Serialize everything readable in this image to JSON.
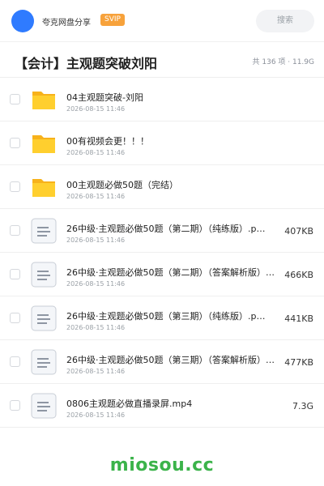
{
  "header": {
    "share_name": "夸克网盘分享",
    "badge": "SVIP",
    "search_placeholder": "搜索",
    "accent_color": "#2f7bff",
    "badge_color": "#f7a23b"
  },
  "titlebar": {
    "title": "【会计】主观题突破刘阳",
    "meta": "共 136 项 · 11.9G"
  },
  "files": [
    {
      "icon": "folder-icon",
      "name": "04主观题突破-刘阳",
      "date": "2026-08-15 11:46",
      "size": ""
    },
    {
      "icon": "folder-icon",
      "name": "00有视频会更！！！",
      "date": "2026-08-15 11:46",
      "size": ""
    },
    {
      "icon": "folder-icon",
      "name": "00主观题必做50题（完结）",
      "date": "2026-08-15 11:46",
      "size": ""
    },
    {
      "icon": "document-icon",
      "name": "26中级·主观题必做50题（第二期）（纯练版）.p…",
      "date": "2026-08-15 11:46",
      "size": "407KB"
    },
    {
      "icon": "document-icon",
      "name": "26中级·主观题必做50题（第二期）（答案解析版）…",
      "date": "2026-08-15 11:46",
      "size": "466KB"
    },
    {
      "icon": "document-icon",
      "name": "26中级·主观题必做50题（第三期）（纯练版）.p…",
      "date": "2026-08-15 11:46",
      "size": "441KB"
    },
    {
      "icon": "document-icon",
      "name": "26中级·主观题必做50题（第三期）（答案解析版）…",
      "date": "2026-08-15 11:46",
      "size": "477KB"
    },
    {
      "icon": "document-icon",
      "name": "0806主观题必做直播录屏.mp4",
      "date": "2026-08-15 11:46",
      "size": "7.3G"
    }
  ],
  "footer": {
    "watermark": "miosou.cc",
    "watermark_color": "#3bb34a"
  }
}
